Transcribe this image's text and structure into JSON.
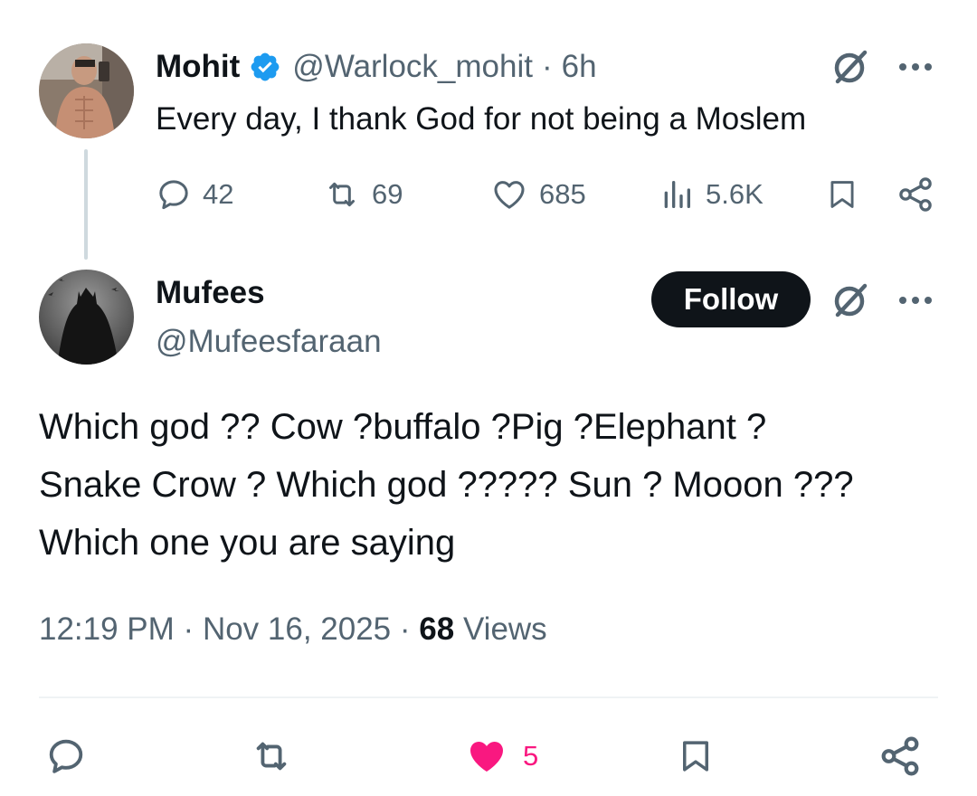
{
  "parent_tweet": {
    "display_name": "Mohit",
    "handle": "@Warlock_mohit",
    "separator": "·",
    "time_ago": "6h",
    "text": "Every day, I thank God for not being a Moslem",
    "stats": {
      "replies": "42",
      "reposts": "69",
      "likes": "685",
      "views": "5.6K"
    }
  },
  "reply_tweet": {
    "display_name": "Mufees",
    "handle": "@Mufeesfaraan",
    "follow_label": "Follow",
    "text_lines": [
      "Which god ?? Cow ?buffalo ?Pig ?Elephant ?",
      "Snake Crow ? Which god ????? Sun ? Mooon ???",
      "Which one you are saying"
    ],
    "meta": {
      "time": "12:19 PM",
      "separator": "·",
      "date": "Nov 16, 2025",
      "views_count": "68",
      "views_label": "Views"
    },
    "likes": "5"
  },
  "icons": {
    "reply": "reply-icon",
    "repost": "repost-icon",
    "like": "heart-icon",
    "views": "views-icon",
    "bookmark": "bookmark-icon",
    "share": "share-icon",
    "grok": "grok-icon",
    "more": "more-icon",
    "verified": "verified-badge-icon"
  },
  "colors": {
    "text_primary": "#0f1419",
    "text_secondary": "#536471",
    "verified_blue": "#1d9bf0",
    "like_pink": "#f91880",
    "follow_button_bg": "#0f1419"
  }
}
